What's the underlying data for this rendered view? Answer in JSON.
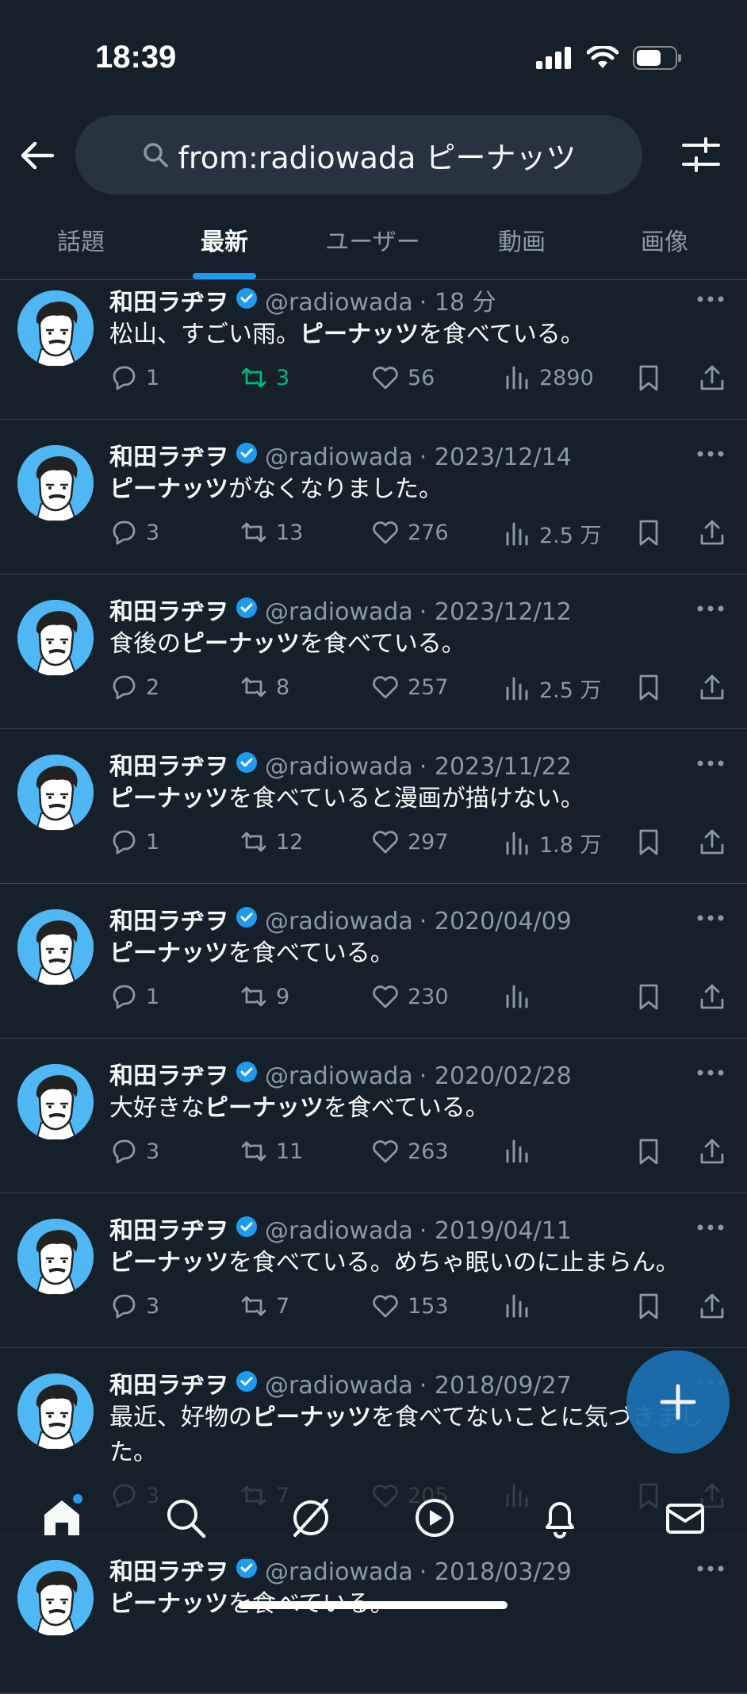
{
  "status_bar": {
    "time": "18:39"
  },
  "search": {
    "query": "from:radiowada ピーナッツ"
  },
  "tabs": [
    {
      "label": "話題"
    },
    {
      "label": "最新",
      "active": true
    },
    {
      "label": "ユーザー"
    },
    {
      "label": "動画"
    },
    {
      "label": "画像"
    }
  ],
  "tweets": [
    {
      "name": "和田ラヂヲ",
      "handle": "@radiowada",
      "time": "· 18 分",
      "text_parts": [
        "松山、すごい雨。",
        "ピーナッツ",
        "を食べている。"
      ],
      "replies": "1",
      "retweets": "3",
      "retweeted": true,
      "likes": "56",
      "views": "2890"
    },
    {
      "name": "和田ラヂヲ",
      "handle": "@radiowada",
      "time": "· 2023/12/14",
      "text_parts": [
        "",
        "ピーナッツ",
        "がなくなりました。"
      ],
      "replies": "3",
      "retweets": "13",
      "likes": "276",
      "views": "2.5 万"
    },
    {
      "name": "和田ラヂヲ",
      "handle": "@radiowada",
      "time": "· 2023/12/12",
      "text_parts": [
        "食後の",
        "ピーナッツ",
        "を食べている。"
      ],
      "replies": "2",
      "retweets": "8",
      "likes": "257",
      "views": "2.5 万"
    },
    {
      "name": "和田ラヂヲ",
      "handle": "@radiowada",
      "time": "· 2023/11/22",
      "text_parts": [
        "",
        "ピーナッツ",
        "を食べていると漫画が描けない。"
      ],
      "replies": "1",
      "retweets": "12",
      "likes": "297",
      "views": "1.8 万"
    },
    {
      "name": "和田ラヂヲ",
      "handle": "@radiowada",
      "time": "· 2020/04/09",
      "text_parts": [
        "",
        "ピーナッツ",
        "を食べている。"
      ],
      "replies": "1",
      "retweets": "9",
      "likes": "230",
      "views": ""
    },
    {
      "name": "和田ラヂヲ",
      "handle": "@radiowada",
      "time": "· 2020/02/28",
      "text_parts": [
        "大好きな",
        "ピーナッツ",
        "を食べている。"
      ],
      "replies": "3",
      "retweets": "11",
      "likes": "263",
      "views": ""
    },
    {
      "name": "和田ラヂヲ",
      "handle": "@radiowada",
      "time": "· 2019/04/11",
      "text_parts": [
        "",
        "ピーナッツ",
        "を食べている。めちゃ眠いのに止まらん。"
      ],
      "replies": "3",
      "retweets": "7",
      "likes": "153",
      "views": ""
    },
    {
      "name": "和田ラヂヲ",
      "handle": "@radiowada",
      "time": "· 2018/09/27",
      "text_parts": [
        "最近、好物の",
        "ピーナッツ",
        "を食べてないことに気づきました。"
      ],
      "replies": "3",
      "retweets": "7",
      "likes": "205",
      "views": ""
    },
    {
      "name": "和田ラヂヲ",
      "handle": "@radiowada",
      "time": "· 2018/03/29",
      "text_parts": [
        "",
        "ピーナッツ",
        "を食べている。"
      ],
      "replies": "",
      "retweets": "",
      "likes": "",
      "views": ""
    }
  ],
  "bottom_nav": [
    {
      "icon": "home-icon",
      "active": true
    },
    {
      "icon": "search-icon"
    },
    {
      "icon": "grok-icon"
    },
    {
      "icon": "video-icon"
    },
    {
      "icon": "notifications-icon"
    },
    {
      "icon": "messages-icon"
    }
  ],
  "colors": {
    "background": "#15202b",
    "accent": "#1d9bf0",
    "retweet_active": "#00ba7c",
    "muted": "#8b98a5"
  }
}
